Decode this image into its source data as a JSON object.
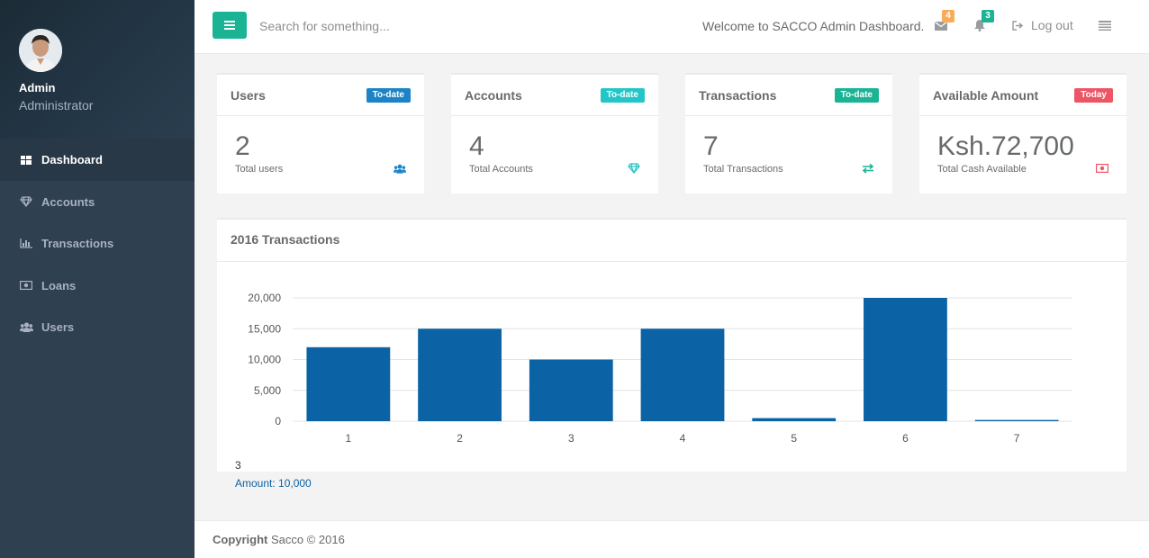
{
  "profile": {
    "name": "Admin",
    "role": "Administrator"
  },
  "sidebar": {
    "items": [
      {
        "label": "Dashboard",
        "icon": "dashboard-icon",
        "active": true
      },
      {
        "label": "Accounts",
        "icon": "diamond-icon"
      },
      {
        "label": "Transactions",
        "icon": "bar-chart-icon"
      },
      {
        "label": "Loans",
        "icon": "money-icon"
      },
      {
        "label": "Users",
        "icon": "users-icon"
      }
    ]
  },
  "topbar": {
    "search_placeholder": "Search for something...",
    "welcome": "Welcome to SACCO Admin Dashboard.",
    "messages_count": "4",
    "alerts_count": "3",
    "logout_label": "Log out"
  },
  "cards": [
    {
      "title": "Users",
      "badge": "To-date",
      "badge_color": "#1c84c6",
      "value": "2",
      "subtitle": "Total users",
      "icon": "users-icon",
      "icon_color": "#1c84c6"
    },
    {
      "title": "Accounts",
      "badge": "To-date",
      "badge_color": "#23c6c8",
      "value": "4",
      "subtitle": "Total Accounts",
      "icon": "diamond-icon",
      "icon_color": "#23c6c8"
    },
    {
      "title": "Transactions",
      "badge": "To-date",
      "badge_color": "#1ab394",
      "value": "7",
      "subtitle": "Total Transactions",
      "icon": "exchange-icon",
      "icon_color": "#1ab394"
    },
    {
      "title": "Available Amount",
      "badge": "Today",
      "badge_color": "#ed5565",
      "value": "Ksh.72,700",
      "subtitle": "Total Cash Available",
      "icon": "money-icon",
      "icon_color": "#ed5565"
    }
  ],
  "chart_panel": {
    "title": "2016 Transactions"
  },
  "chart_data": {
    "type": "bar",
    "categories": [
      "1",
      "2",
      "3",
      "4",
      "5",
      "6",
      "7"
    ],
    "values": [
      12000,
      15000,
      10000,
      15000,
      500,
      20000,
      200
    ],
    "ylim": [
      0,
      20000
    ],
    "yticks": [
      0,
      5000,
      10000,
      15000,
      20000
    ],
    "ytick_labels": [
      "0",
      "5,000",
      "10,000",
      "15,000",
      "20,000"
    ],
    "grid": true,
    "bar_color": "#0b62a4"
  },
  "tooltip": {
    "category": "3",
    "text": "Amount: 10,000"
  },
  "footer": {
    "bold": "Copyright",
    "text": " Sacco © 2016"
  }
}
